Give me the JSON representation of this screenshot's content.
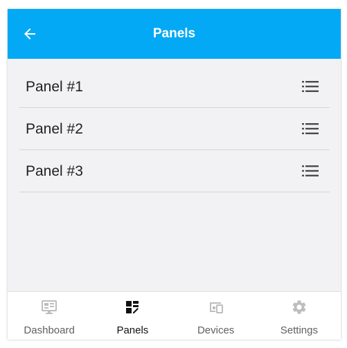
{
  "appbar": {
    "title": "Panels",
    "back_icon": "arrow-left-icon"
  },
  "panels": [
    {
      "label": "Panel #1",
      "icon": "list-menu-icon"
    },
    {
      "label": "Panel #2",
      "icon": "list-menu-icon"
    },
    {
      "label": "Panel #3",
      "icon": "list-menu-icon"
    }
  ],
  "bottom_nav": {
    "active": "Panels",
    "items": [
      {
        "label": "Dashboard",
        "icon": "dashboard-icon"
      },
      {
        "label": "Panels",
        "icon": "panels-icon"
      },
      {
        "label": "Devices",
        "icon": "devices-icon"
      },
      {
        "label": "Settings",
        "icon": "gear-icon"
      }
    ]
  },
  "colors": {
    "appbar": "#03a9f4",
    "background": "#f2f2f4",
    "active_nav": "#111111",
    "inactive_nav": "#bdbdbd"
  }
}
